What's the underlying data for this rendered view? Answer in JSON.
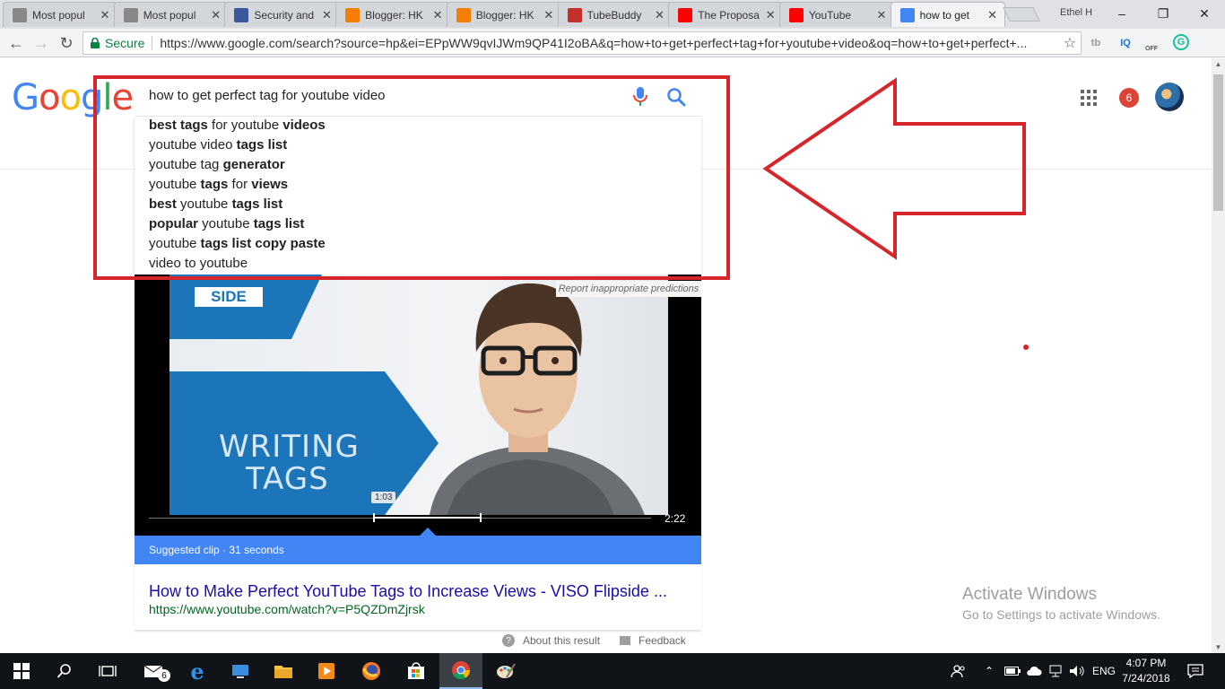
{
  "browser": {
    "tabs": [
      {
        "label": "Most popul",
        "favicon": "blank-page-icon",
        "color": "#888888",
        "active": false
      },
      {
        "label": "Most popul",
        "favicon": "blank-page-icon",
        "color": "#888888",
        "active": false
      },
      {
        "label": "Security and",
        "favicon": "facebook-icon",
        "color": "#3b5998",
        "active": false
      },
      {
        "label": "Blogger: HK",
        "favicon": "blogger-icon",
        "color": "#f57d00",
        "active": false
      },
      {
        "label": "Blogger: HK",
        "favicon": "blogger-icon",
        "color": "#f57d00",
        "active": false
      },
      {
        "label": "TubeBuddy",
        "favicon": "tubebuddy-icon",
        "color": "#c4302b",
        "active": false
      },
      {
        "label": "The Proposa",
        "favicon": "youtube-icon",
        "color": "#ff0000",
        "active": false
      },
      {
        "label": "YouTube",
        "favicon": "youtube-icon",
        "color": "#ff0000",
        "active": false
      },
      {
        "label": "how to get",
        "favicon": "google-icon",
        "color": "#4285f4",
        "active": true
      }
    ],
    "profile_name": "Ethel H",
    "secure_label": "Secure",
    "url": "https://www.google.com/search?source=hp&ei=EPpWW9qvIJWm9QP41I2oBA&q=how+to+get+perfect+tag+for+youtube+video&oq=how+to+get+perfect+...",
    "extensions": [
      {
        "label": "tb",
        "color": "#999999",
        "icon": "tubebuddy-ext-icon"
      },
      {
        "label": "IQ",
        "color": "#1a73e8",
        "icon": "vidiq-ext-icon"
      },
      {
        "label": "OFF",
        "color": "#555555",
        "icon": "ext-off-icon"
      },
      {
        "label": "G",
        "color": "#15c39a",
        "icon": "grammarly-ext-icon"
      }
    ]
  },
  "google": {
    "logo_letters": [
      {
        "ch": "G",
        "color": "#4285f4"
      },
      {
        "ch": "o",
        "color": "#ea4335"
      },
      {
        "ch": "o",
        "color": "#fbbc05"
      },
      {
        "ch": "g",
        "color": "#4285f4"
      },
      {
        "ch": "l",
        "color": "#34a853"
      },
      {
        "ch": "e",
        "color": "#ea4335"
      }
    ],
    "query": "how to get perfect tag for youtube video",
    "suggestions": [
      [
        {
          "t": "best tags",
          "b": true
        },
        {
          "t": " for youtube ",
          "b": false
        },
        {
          "t": "videos",
          "b": true
        }
      ],
      [
        {
          "t": "youtube video ",
          "b": false
        },
        {
          "t": "tags list",
          "b": true
        }
      ],
      [
        {
          "t": "youtube tag ",
          "b": false
        },
        {
          "t": "generator",
          "b": true
        }
      ],
      [
        {
          "t": "youtube ",
          "b": false
        },
        {
          "t": "tags",
          "b": true
        },
        {
          "t": " for ",
          "b": false
        },
        {
          "t": "views",
          "b": true
        }
      ],
      [
        {
          "t": "best",
          "b": true
        },
        {
          "t": " youtube ",
          "b": false
        },
        {
          "t": "tags list",
          "b": true
        }
      ],
      [
        {
          "t": "popular",
          "b": true
        },
        {
          "t": " youtube ",
          "b": false
        },
        {
          "t": "tags list",
          "b": true
        }
      ],
      [
        {
          "t": "youtube ",
          "b": false
        },
        {
          "t": "tags list copy paste",
          "b": true
        }
      ],
      [
        {
          "t": "video to youtube",
          "b": false
        }
      ]
    ],
    "report_predictions": "Report inappropriate predictions",
    "notification_count": "6"
  },
  "video": {
    "badge_text": "SIDE",
    "title_line1": "WRITING",
    "title_line2": "TAGS",
    "clip_time": "1:03",
    "duration": "2:22",
    "suggested_clip": "Suggested clip · 31 seconds",
    "result_title": "How to Make Perfect YouTube Tags to Increase Views - VISO Flipside ...",
    "result_url": "https://www.youtube.com/watch?v=P5QZDmZjrsk",
    "about_label": "About this result",
    "feedback_label": "Feedback"
  },
  "watermark": {
    "line1": "Activate Windows",
    "line2": "Go to Settings to activate Windows."
  },
  "taskbar": {
    "mail_badge": "6",
    "language": "ENG",
    "time": "4:07 PM",
    "date": "7/24/2018"
  },
  "colors": {
    "annotation_red": "#d7262b",
    "suggested_blue": "#4285f4",
    "link_blue": "#1a0dab",
    "url_green": "#006621"
  }
}
